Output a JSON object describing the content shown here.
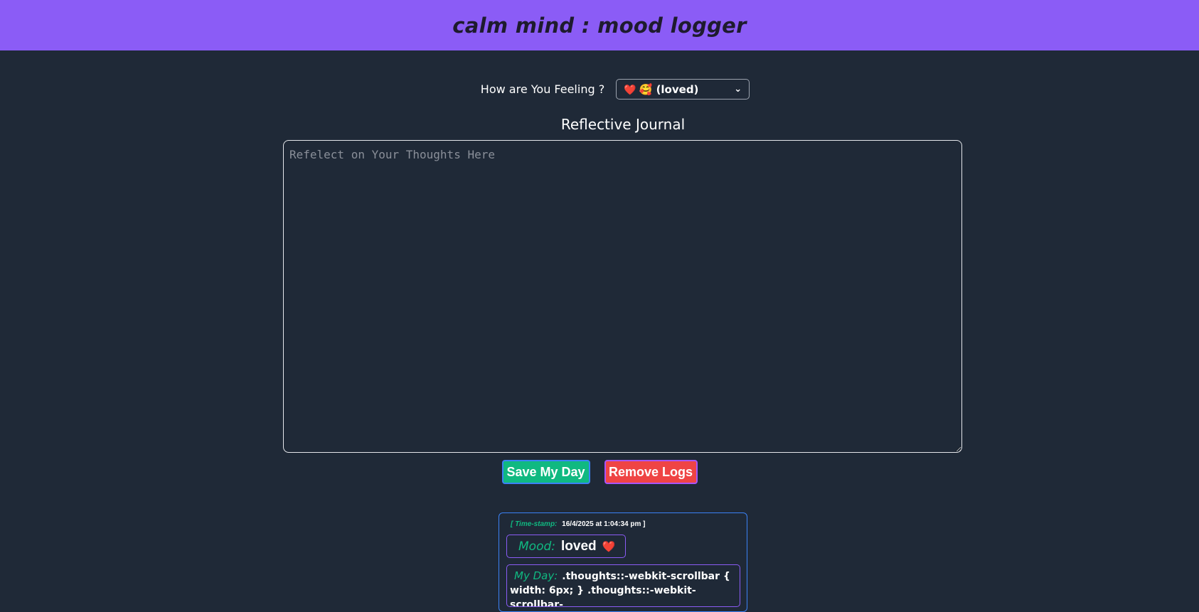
{
  "header": {
    "title": "calm mind : mood logger"
  },
  "mood_picker": {
    "label": "How are You Feeling ?",
    "selected": "(loved)",
    "selected_emoji_1": "❤️",
    "selected_emoji_2": "🥰",
    "chevron_icon": "chevron-down-icon"
  },
  "journal": {
    "title": "Reflective Journal",
    "placeholder": "Refelect on Your Thoughts Here",
    "value": ""
  },
  "buttons": {
    "save_label": "Save My Day",
    "remove_label": "Remove Logs"
  },
  "logs": [
    {
      "timestamp_label": "[ Time-stamp:",
      "timestamp_value": "16/4/2025 at 1:04:34 pm ]",
      "mood_label": "Mood:",
      "mood_value": "loved",
      "mood_emoji": "❤️",
      "day_label": "My Day:",
      "day_value": ".thoughts::-webkit-scrollbar { width: 6px; } .thoughts::-webkit-scrollbar-"
    }
  ],
  "colors": {
    "header_bg": "#8b5cf6",
    "page_bg": "#1f2937",
    "accent_green": "#10b981",
    "accent_red": "#ef4444",
    "border_blue": "#3b82f6",
    "border_purple": "#8b5cf6"
  }
}
